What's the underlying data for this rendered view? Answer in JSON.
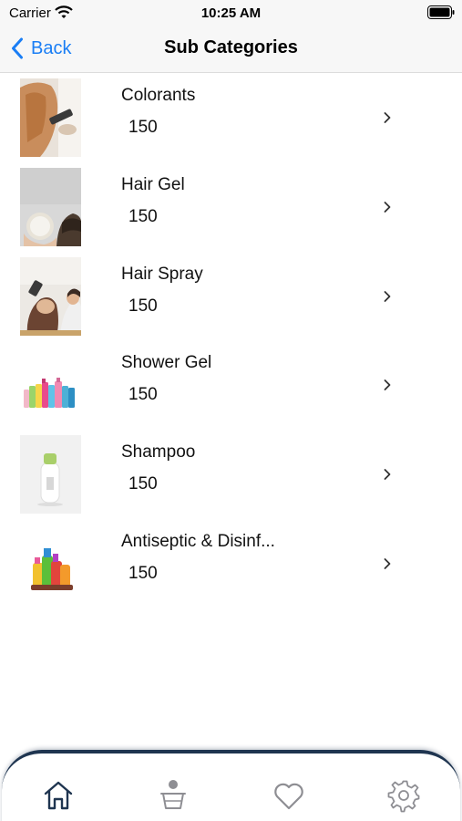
{
  "status_bar": {
    "carrier": "Carrier",
    "time": "10:25 AM"
  },
  "nav": {
    "back_label": "Back",
    "title": "Sub Categories"
  },
  "subcategories": [
    {
      "name": "Colorants",
      "count": "150"
    },
    {
      "name": "Hair Gel",
      "count": "150"
    },
    {
      "name": "Hair Spray",
      "count": "150"
    },
    {
      "name": "Shower Gel",
      "count": "150"
    },
    {
      "name": "Shampoo",
      "count": "150"
    },
    {
      "name": "Antiseptic & Disinf...",
      "count": "150"
    }
  ],
  "tabs": [
    {
      "icon": "home-icon",
      "active": true
    },
    {
      "icon": "basket-icon",
      "active": false
    },
    {
      "icon": "heart-icon",
      "active": false
    },
    {
      "icon": "settings-gear-icon",
      "active": false
    }
  ],
  "colors": {
    "accent": "#1a7ef5",
    "tab_active": "#1f3550",
    "tab_inactive": "#8e8e93",
    "bar_background": "#f7f7f7"
  }
}
